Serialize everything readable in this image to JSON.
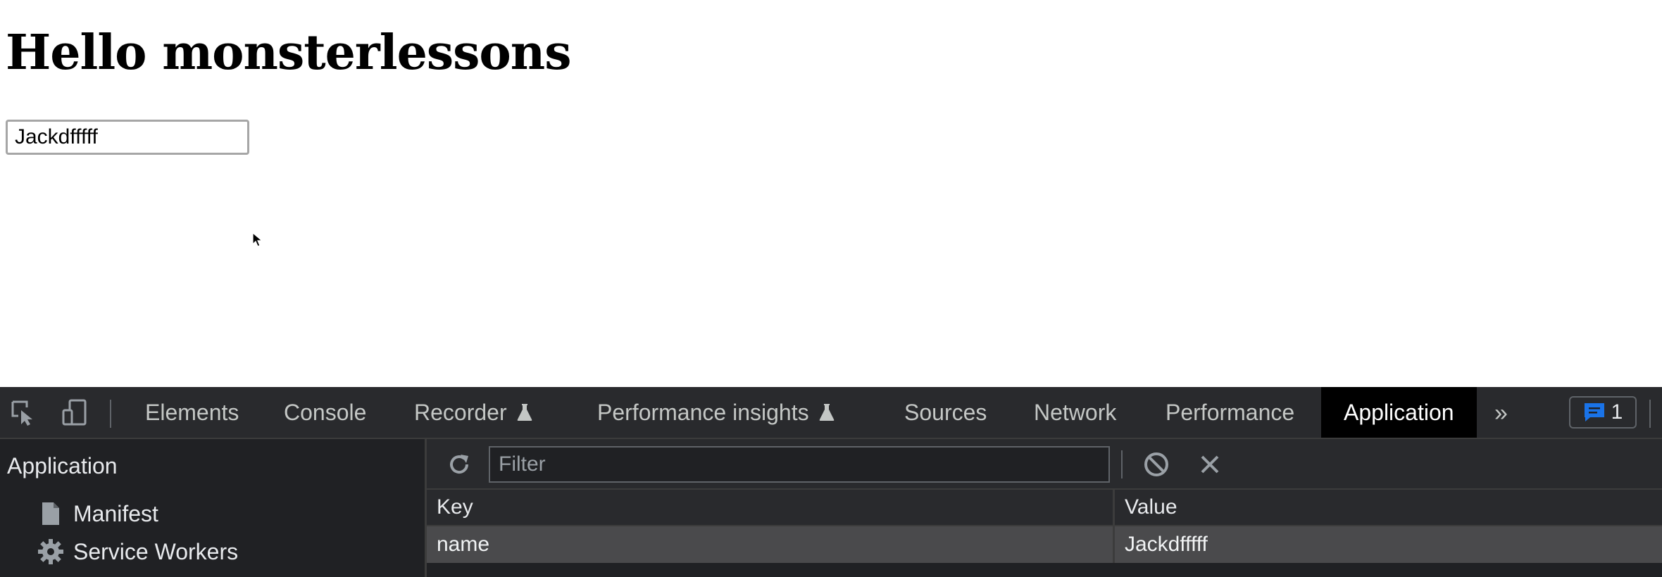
{
  "page": {
    "heading": "Hello monsterlessons",
    "input_value": "Jackdfffff"
  },
  "devtools": {
    "toolbar": {
      "inspect_icon": "inspect-element-icon",
      "device_icon": "device-toolbar-icon",
      "tabs": [
        {
          "label": "Elements",
          "experimental": false
        },
        {
          "label": "Console",
          "experimental": false
        },
        {
          "label": "Recorder",
          "experimental": true
        },
        {
          "label": "Performance insights",
          "experimental": true
        },
        {
          "label": "Sources",
          "experimental": false
        },
        {
          "label": "Network",
          "experimental": false
        },
        {
          "label": "Performance",
          "experimental": false
        },
        {
          "label": "Application",
          "experimental": false,
          "active": true
        }
      ],
      "more_tabs_label": "»",
      "issues_count": "1"
    },
    "sidebar": {
      "heading": "Application",
      "items": [
        {
          "label": "Manifest",
          "icon": "file-icon"
        },
        {
          "label": "Service Workers",
          "icon": "gear-icon"
        }
      ]
    },
    "storage": {
      "filter_placeholder": "Filter",
      "columns": {
        "key": "Key",
        "value": "Value"
      },
      "rows": [
        {
          "key": "name",
          "value": "Jackdfffff"
        }
      ]
    },
    "colors": {
      "panel_bg": "#202124",
      "toolbar_bg": "#292a2d",
      "active_tab_bg": "#000000",
      "selected_row_bg": "#4a4a4c",
      "issues_accent": "#1a73e8"
    }
  }
}
